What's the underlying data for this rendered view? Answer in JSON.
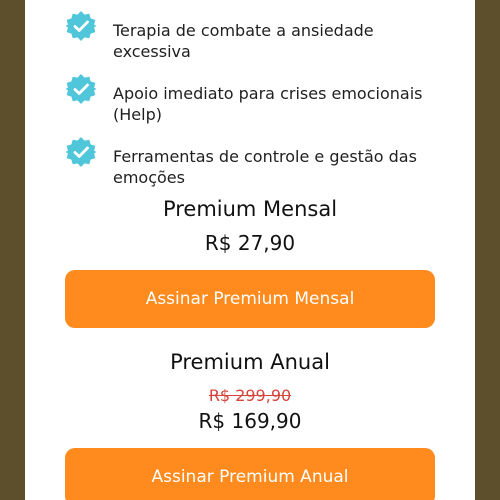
{
  "colors": {
    "background": "#5e4f2c",
    "card": "#ffffff",
    "check_badge": "#4fc6da",
    "button": "#ff8a1d",
    "old_price": "#d6453b"
  },
  "features": [
    {
      "icon": "check-badge-icon",
      "text": "Terapia de combate a ansiedade excessiva"
    },
    {
      "icon": "check-badge-icon",
      "text": "Apoio imediato para crises emocionais (Help)"
    },
    {
      "icon": "check-badge-icon",
      "text": "Ferramentas de controle e gestão das emoções"
    }
  ],
  "plans": {
    "monthly": {
      "title": "Premium Mensal",
      "price": "R$ 27,90",
      "button_label": "Assinar Premium Mensal"
    },
    "annual": {
      "title": "Premium Anual",
      "old_price": "R$ 299,90",
      "price": "R$ 169,90",
      "button_label": "Assinar Premium Anual"
    }
  }
}
